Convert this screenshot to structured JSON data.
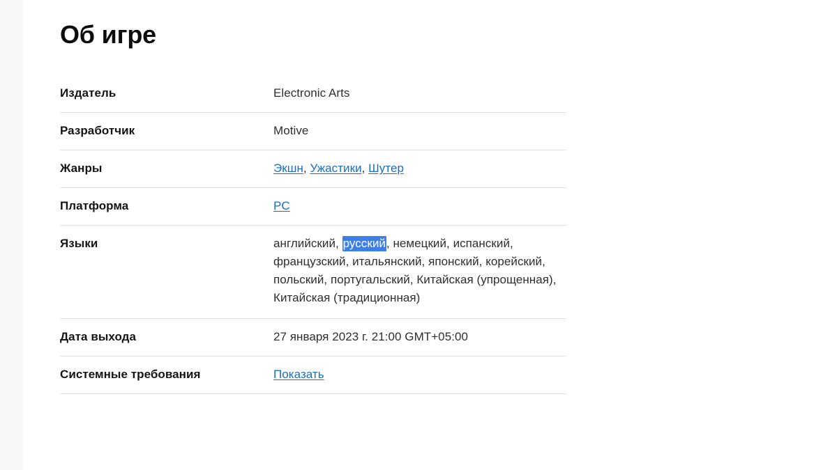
{
  "page": {
    "title": "Об игре",
    "background_color": "#ffffff",
    "gutter_color": "#f7f7f8",
    "link_color": "#1a6ec0",
    "selection_color": "#3d7fe8",
    "divider_color": "#e2e2e2"
  },
  "rows": [
    {
      "key": "publisher",
      "label": "Издатель",
      "value": "Electronic Arts",
      "type": "text"
    },
    {
      "key": "developer",
      "label": "Разработчик",
      "value": "Motive",
      "type": "text"
    },
    {
      "key": "genres",
      "label": "Жанры",
      "type": "links",
      "links": [
        "Экшн",
        "Ужастики",
        "Шутер"
      ],
      "separator": ", "
    },
    {
      "key": "platform",
      "label": "Платформа",
      "type": "links",
      "links": [
        "PC"
      ],
      "separator": ", "
    },
    {
      "key": "languages",
      "label": "Языки",
      "type": "languages",
      "before_selection": "английский, ",
      "selected": "русский",
      "after_selection": ", немецкий, испанский, французский, итальянский, японский, корейский, польский, португальский, Китайская (упрощенная), Китайская (традиционная)"
    },
    {
      "key": "release_date",
      "label": "Дата выхода",
      "value": "27 января 2023 г. 21:00 GMT+05:00",
      "type": "text"
    },
    {
      "key": "system_requirements",
      "label": "Системные требования",
      "type": "links",
      "links": [
        "Показать"
      ],
      "separator": ", "
    }
  ]
}
